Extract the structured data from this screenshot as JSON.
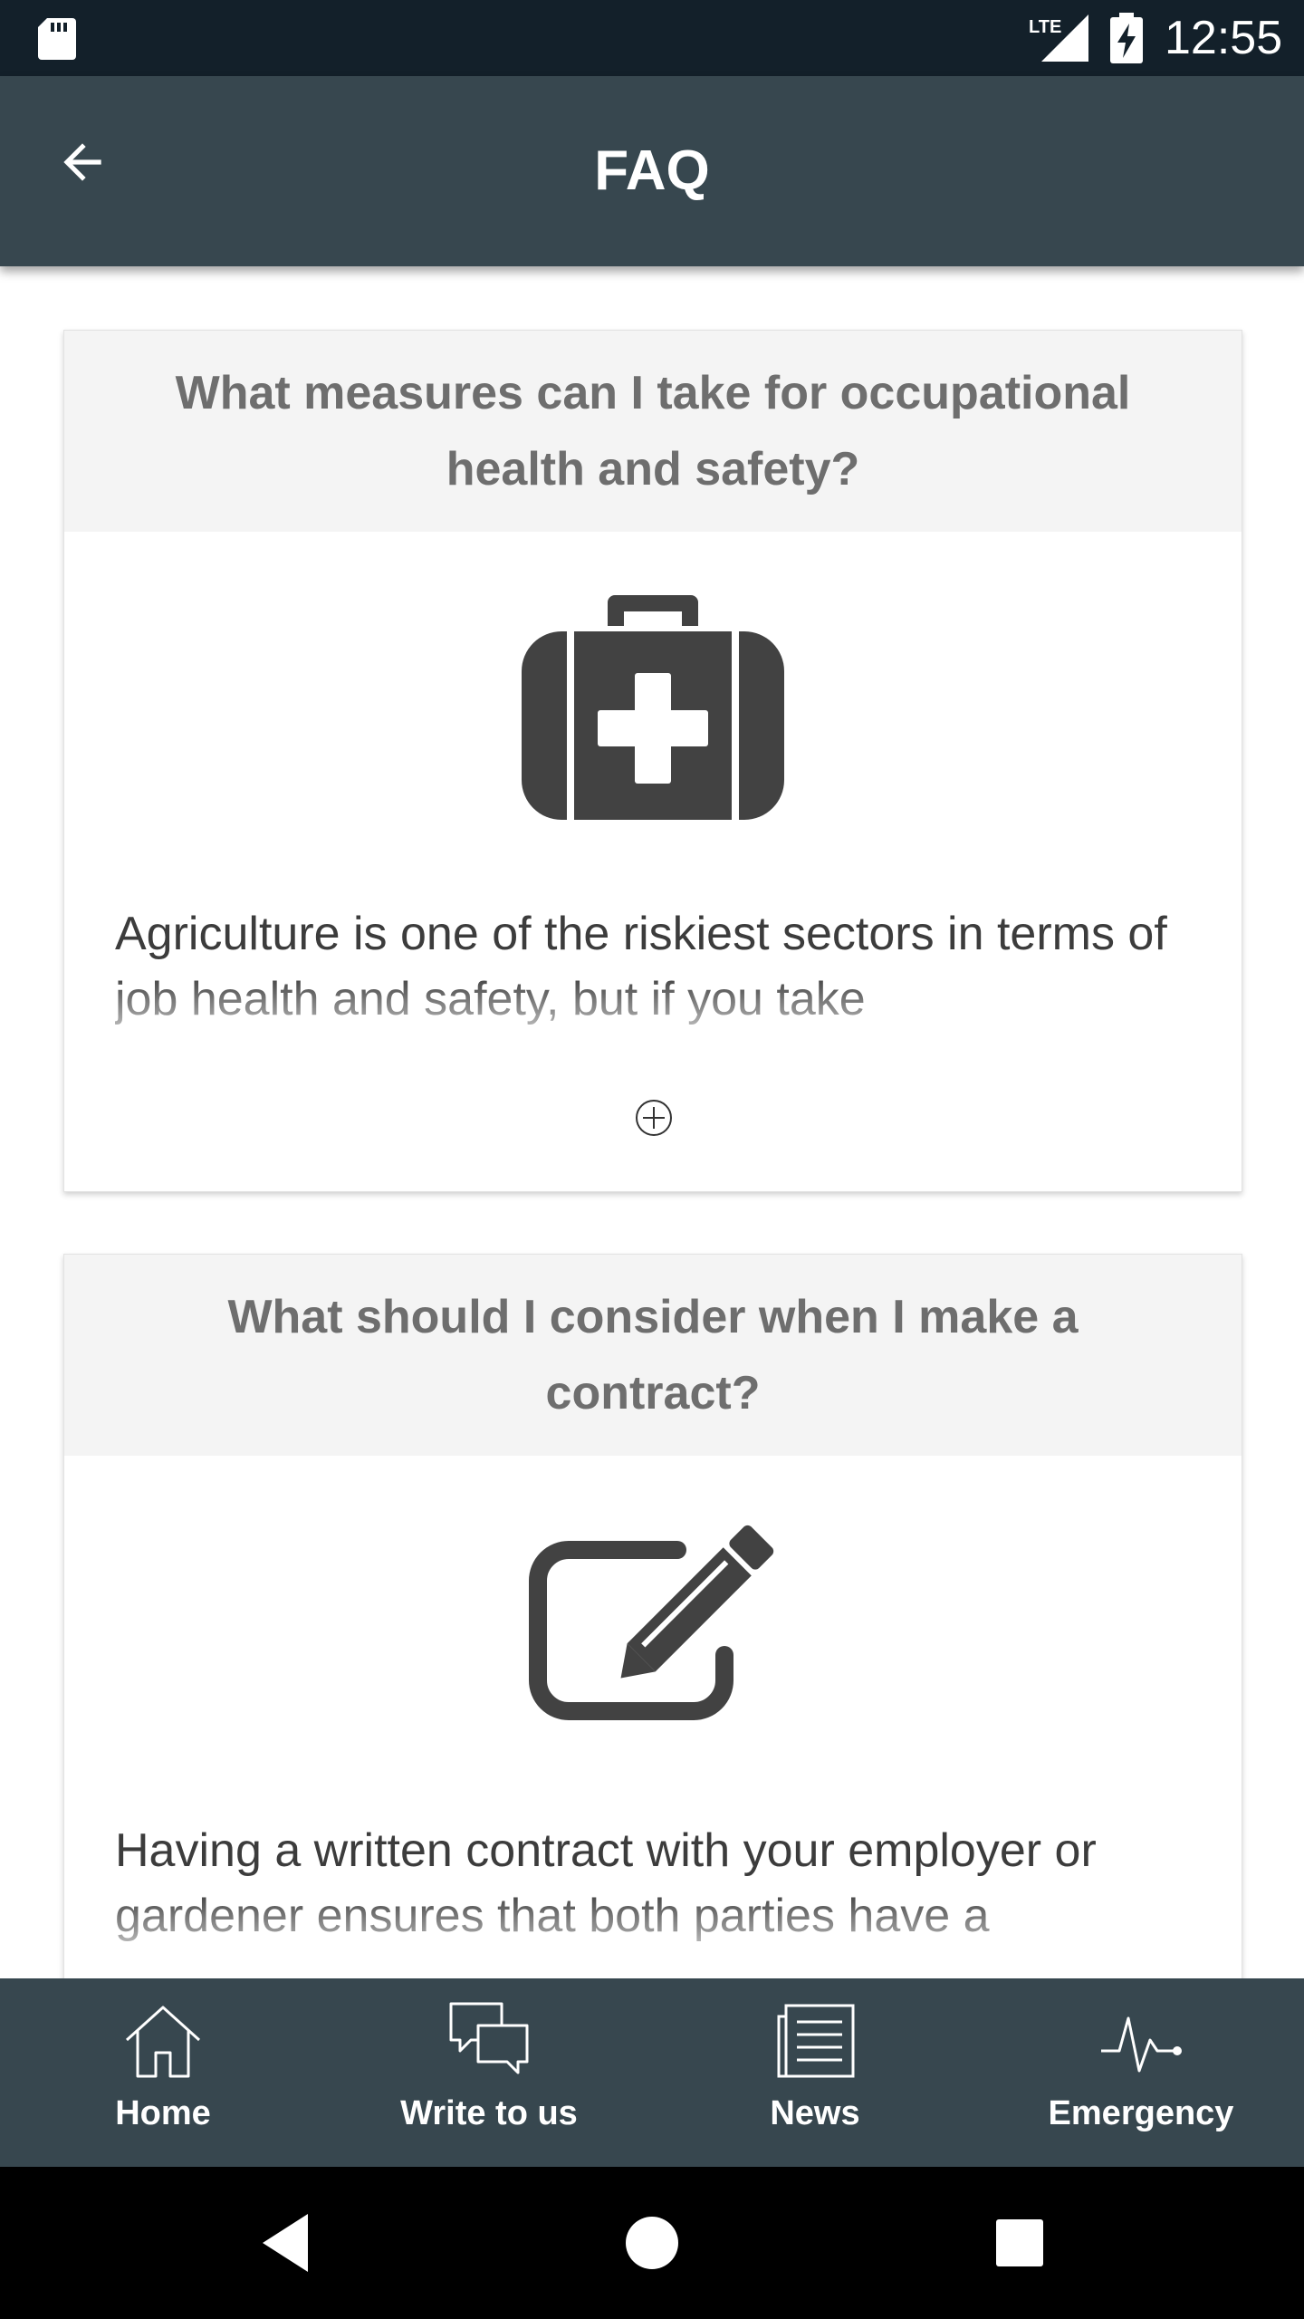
{
  "status_bar": {
    "time": "12:55",
    "network": "LTE",
    "icons": [
      "sd-card-icon",
      "lte-signal-icon",
      "battery-charging-icon"
    ]
  },
  "app_bar": {
    "title": "FAQ",
    "back_icon": "arrow-back-icon"
  },
  "faq": [
    {
      "question": "What measures can I take for occupational health and safety?",
      "icon": "first-aid-kit-icon",
      "answer": "Agriculture is one of the riskiest sectors in terms of job health and safety, but if you take",
      "expand_icon": "plus-circle-icon"
    },
    {
      "question": "What should I consider when I make a contract?",
      "icon": "edit-pencil-icon",
      "answer": "Having a written contract with your employer or gardener ensures that both parties have a"
    }
  ],
  "bottom_nav": [
    {
      "label": "Home",
      "icon": "home-icon"
    },
    {
      "label": "Write to us",
      "icon": "chat-bubbles-icon"
    },
    {
      "label": "News",
      "icon": "newspaper-icon"
    },
    {
      "label": "Emergency",
      "icon": "heartbeat-icon"
    }
  ],
  "system_nav": [
    "back-triangle-icon",
    "home-circle-icon",
    "recents-square-icon"
  ],
  "colors": {
    "status_bar": "#13202a",
    "app_bar": "#37474f",
    "card_header": "#f4f4f4",
    "question_text": "#6e6e6e",
    "icon_dark": "#424242"
  }
}
